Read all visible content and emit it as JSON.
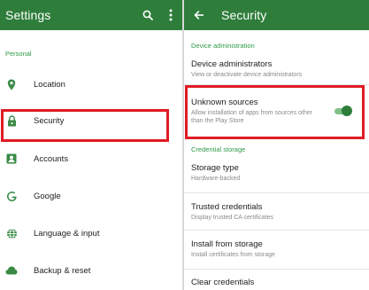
{
  "colors": {
    "appbar": "#2e7d3a",
    "accent": "#2e9a45",
    "highlight": "#e01b24",
    "divider": "#d8d8d8"
  },
  "settings": {
    "title": "Settings",
    "section": "Personal",
    "items": [
      {
        "label": "Location",
        "icon": "location-pin-icon"
      },
      {
        "label": "Security",
        "icon": "lock-icon"
      },
      {
        "label": "Accounts",
        "icon": "accounts-icon"
      },
      {
        "label": "Google",
        "icon": "google-icon"
      },
      {
        "label": "Language & input",
        "icon": "globe-icon"
      },
      {
        "label": "Backup & reset",
        "icon": "cloud-icon"
      }
    ]
  },
  "security": {
    "title": "Security",
    "device_section": "Device administration",
    "credential_section": "Credential storage",
    "items": [
      {
        "title": "Device administrators",
        "subtitle": "View or deactivate device administrators"
      },
      {
        "title": "Unknown sources",
        "subtitle": "Allow installation of apps from sources other than the Play Store",
        "toggle": true
      },
      {
        "title": "Storage type",
        "subtitle": "Hardware-backed"
      },
      {
        "title": "Trusted credentials",
        "subtitle": "Display trusted CA certificates"
      },
      {
        "title": "Install from storage",
        "subtitle": "Install certificates from storage"
      },
      {
        "title": "Clear credentials",
        "subtitle": ""
      }
    ]
  }
}
